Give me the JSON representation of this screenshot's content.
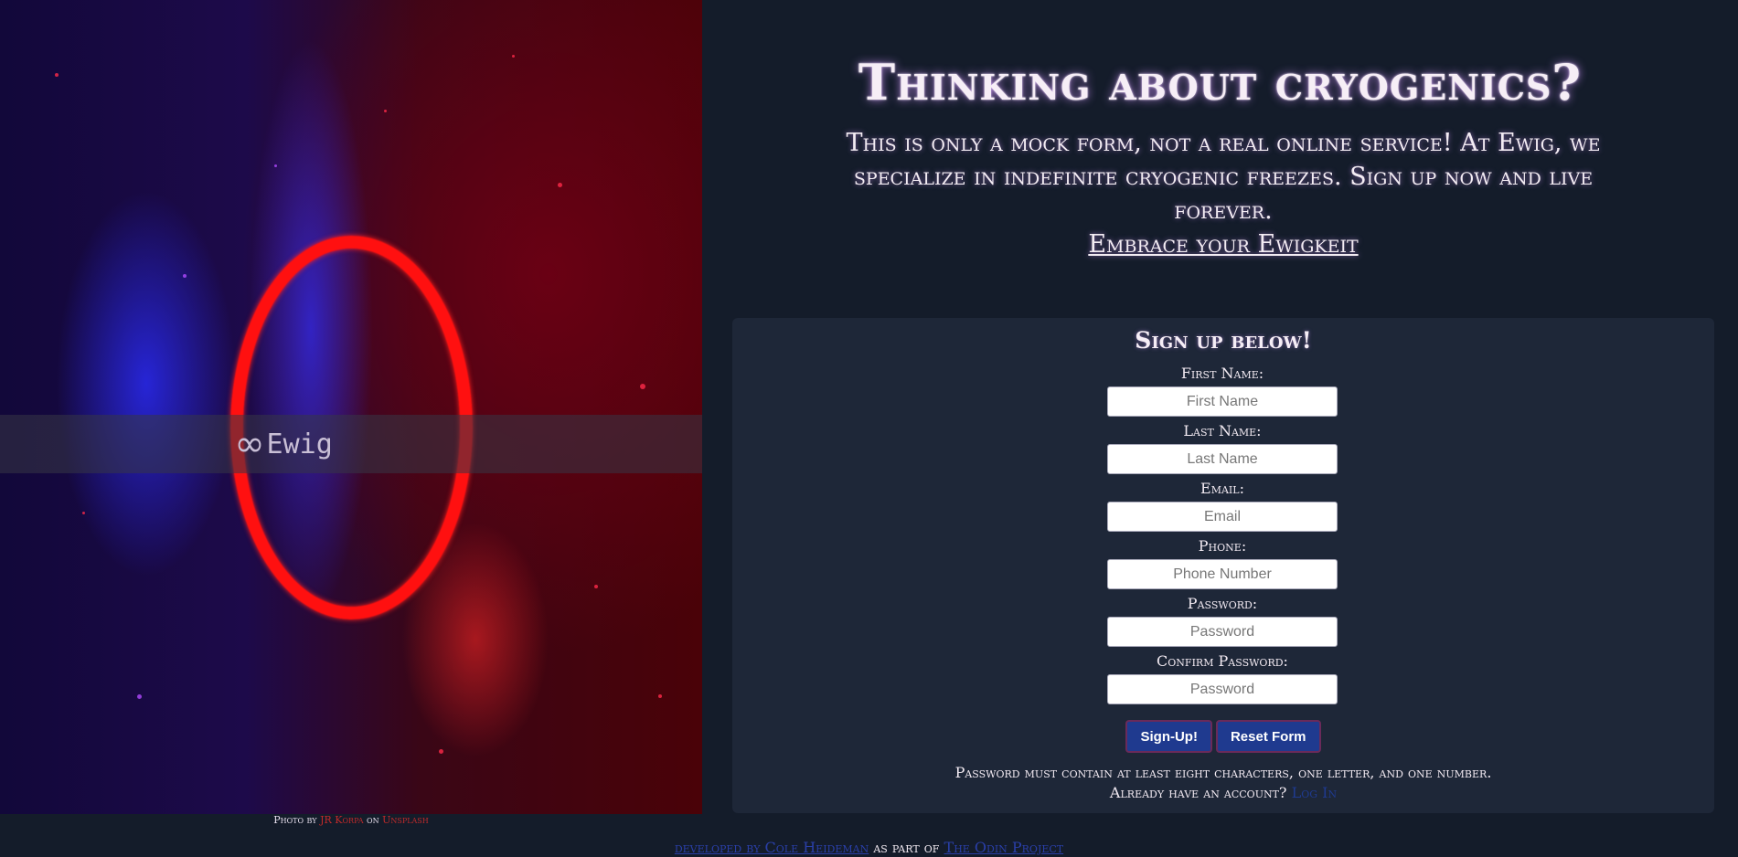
{
  "brand": {
    "name": "Ewig",
    "logo_icon": "infinity-icon"
  },
  "photo_credit": {
    "prefix": "Photo by",
    "author": "JR Korpa",
    "middle": "on",
    "site": "Unsplash"
  },
  "hero": {
    "headline": "Thinking about cryogenics?",
    "intro": "This is only a mock form, not a real online service! At Ewig, we specialize in indefinite cryogenic freezes. Sign up now and live forever.",
    "tagline": "Embrace your Ewigkeit"
  },
  "form": {
    "title": "Sign up below!",
    "fields": [
      {
        "label": "First Name:",
        "placeholder": "First Name"
      },
      {
        "label": "Last Name:",
        "placeholder": "Last Name"
      },
      {
        "label": "Email:",
        "placeholder": "Email"
      },
      {
        "label": "Phone:",
        "placeholder": "Phone Number"
      },
      {
        "label": "Password:",
        "placeholder": "Password"
      },
      {
        "label": "Confirm Password:",
        "placeholder": "Password"
      }
    ],
    "submit_label": "Sign-Up!",
    "reset_label": "Reset Form",
    "password_rule": "Password must contain at least eight characters, one letter, and one number.",
    "account_prompt": "Already have an account?",
    "login_link": "Log In"
  },
  "footer": {
    "developer_link": "developed by Cole Heideman",
    "middle": "as part of",
    "project_link": "The Odin Project"
  },
  "colors": {
    "background": "#141c2a",
    "card": "#1e2738",
    "button": "#1f3a8f",
    "ring": "#ff1010"
  }
}
